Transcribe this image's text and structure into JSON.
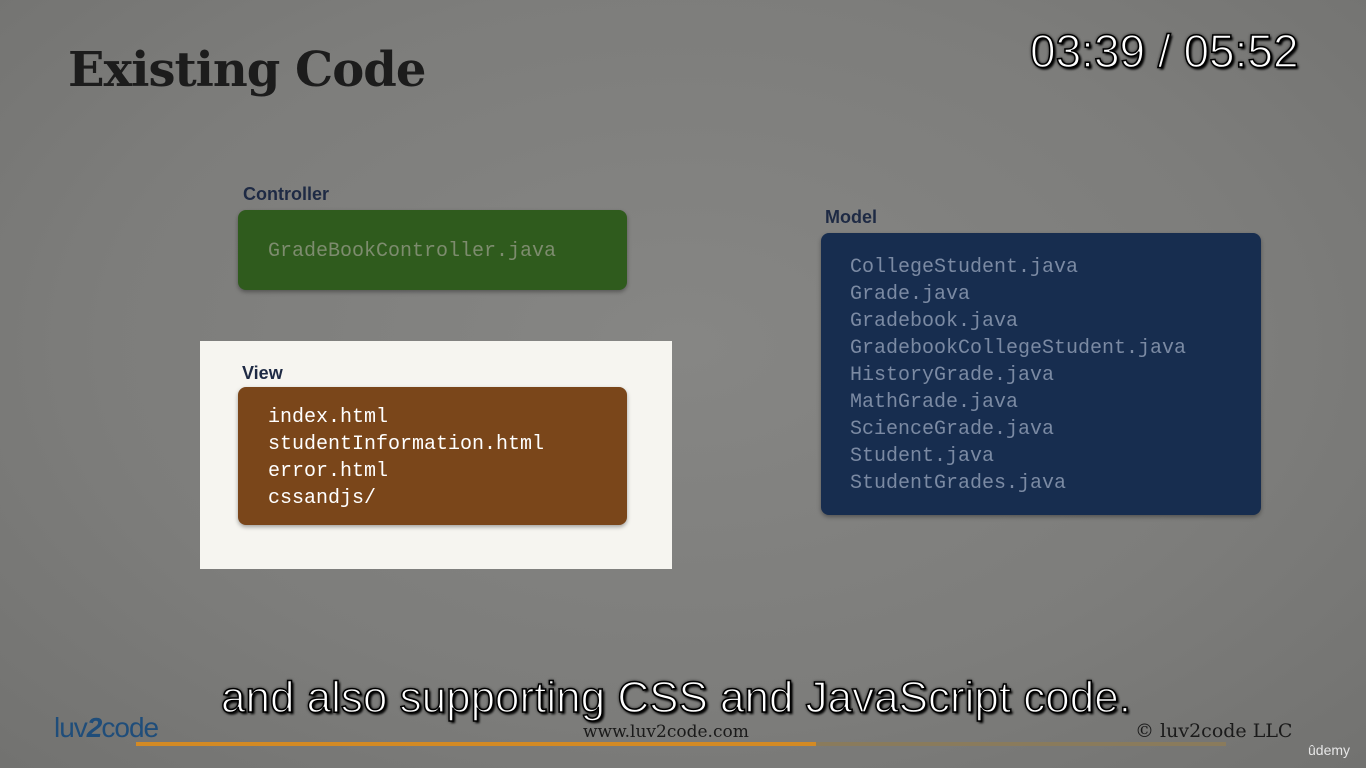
{
  "slide": {
    "title": "Existing Code",
    "controller": {
      "label": "Controller",
      "files": [
        "GradeBookController.java"
      ],
      "color": "#2f5b1d"
    },
    "view": {
      "label": "View",
      "files": [
        "index.html",
        "studentInformation.html",
        "error.html",
        "cssandjs/"
      ],
      "color": "#7a461a",
      "highlighted": true
    },
    "model": {
      "label": "Model",
      "files": [
        "CollegeStudent.java",
        "Grade.java",
        "Gradebook.java",
        "GradebookCollegeStudent.java",
        "HistoryGrade.java",
        "MathGrade.java",
        "ScienceGrade.java",
        "Student.java",
        "StudentGrades.java"
      ],
      "color": "#172d4f"
    }
  },
  "player": {
    "timer": "03:39 / 05:52",
    "caption": "and also supporting CSS and JavaScript code.",
    "progress_fraction": 0.624,
    "accent_color": "#d38a24"
  },
  "footer": {
    "logo_left": "luv",
    "logo_mid": "2",
    "logo_right": "code",
    "url": "www.luv2code.com",
    "copyright": "© luv2code LLC",
    "platform": "ûdemy"
  }
}
